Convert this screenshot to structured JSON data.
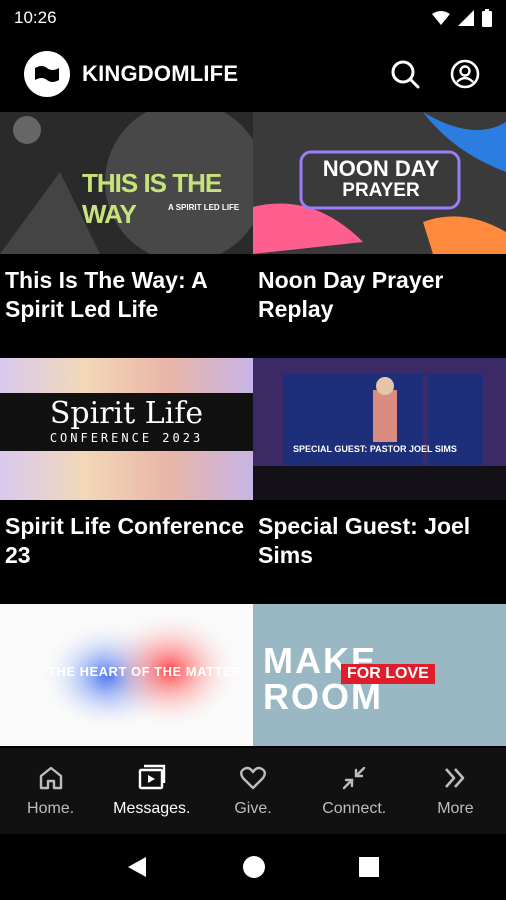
{
  "status": {
    "time": "10:26"
  },
  "app": {
    "name": "KINGDOMLIFE"
  },
  "cards": [
    {
      "title": "This Is The Way: A Spirit Led Life",
      "thumb_main": "THIS IS THE WAY",
      "thumb_sub": "A SPIRIT LED LIFE"
    },
    {
      "title": "Noon Day Prayer Replay",
      "thumb_main": "NOON DAY",
      "thumb_sub": "PRAYER"
    },
    {
      "title": "Spirit Life Conference 23",
      "thumb_main": "Spirit Life",
      "thumb_sub": "CONFERENCE 2023"
    },
    {
      "title": "Special Guest: Joel Sims",
      "thumb_main": "SPECIAL GUEST: PASTOR JOEL SIMS",
      "thumb_sub": ""
    },
    {
      "title": "",
      "thumb_main": "THE HEART OF THE MATTER",
      "thumb_sub": ""
    },
    {
      "title": "",
      "thumb_main": "MAKE",
      "thumb_sub": "ROOM",
      "thumb_tag": "FOR LOVE"
    }
  ],
  "nav": [
    {
      "label": "Home.",
      "icon": "home-icon"
    },
    {
      "label": "Messages.",
      "icon": "messages-icon"
    },
    {
      "label": "Give.",
      "icon": "heart-icon"
    },
    {
      "label": "Connect.",
      "icon": "connect-icon"
    },
    {
      "label": "More",
      "icon": "chevrons-right-icon"
    }
  ]
}
